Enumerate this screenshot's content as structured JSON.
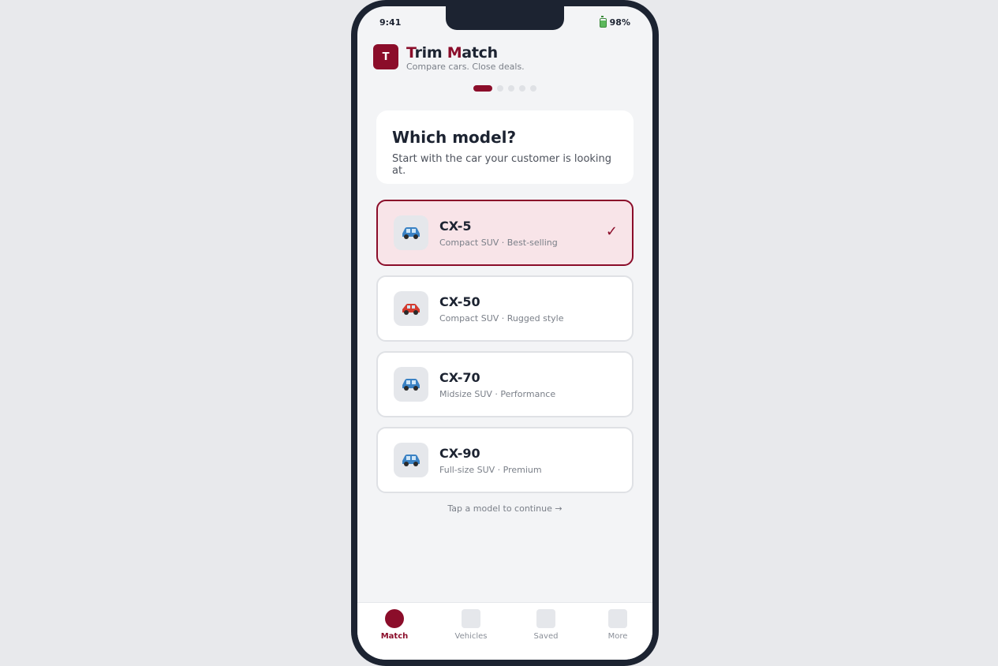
{
  "status": {
    "time": "9:41",
    "battery": "98%"
  },
  "brand": {
    "logo_letter": "T",
    "name_part1_accent": "T",
    "name_part1_rest": "rim ",
    "name_part2_accent": "M",
    "name_part2_rest": "atch",
    "tagline": "Compare cars. Close deals."
  },
  "progress": {
    "current_step": 1,
    "total_steps": 5
  },
  "question": {
    "title": "Which model?",
    "subtitle": "Start with the car your customer is looking at."
  },
  "models": [
    {
      "name": "CX-5",
      "description": "Compact SUV · Best-selling",
      "icon": "blue-car-icon",
      "icon_color": "#3b82c4",
      "selected": true,
      "check": "✓"
    },
    {
      "name": "CX-50",
      "description": "Compact SUV · Rugged style",
      "icon": "red-car-icon",
      "icon_color": "#d43b2e",
      "selected": false
    },
    {
      "name": "CX-70",
      "description": "Midsize SUV · Performance",
      "icon": "blue-car-icon",
      "icon_color": "#3b82c4",
      "selected": false
    },
    {
      "name": "CX-90",
      "description": "Full-size SUV · Premium",
      "icon": "blue-car-icon",
      "icon_color": "#3b82c4",
      "selected": false
    }
  ],
  "hint": "Tap a model to continue →",
  "tabs": [
    {
      "label": "Match",
      "active": true
    },
    {
      "label": "Vehicles",
      "active": false
    },
    {
      "label": "Saved",
      "active": false
    },
    {
      "label": "More",
      "active": false
    }
  ],
  "colors": {
    "accent": "#8b0d2a",
    "selected_bg": "#f8e4e8",
    "text": "#1c2331"
  }
}
